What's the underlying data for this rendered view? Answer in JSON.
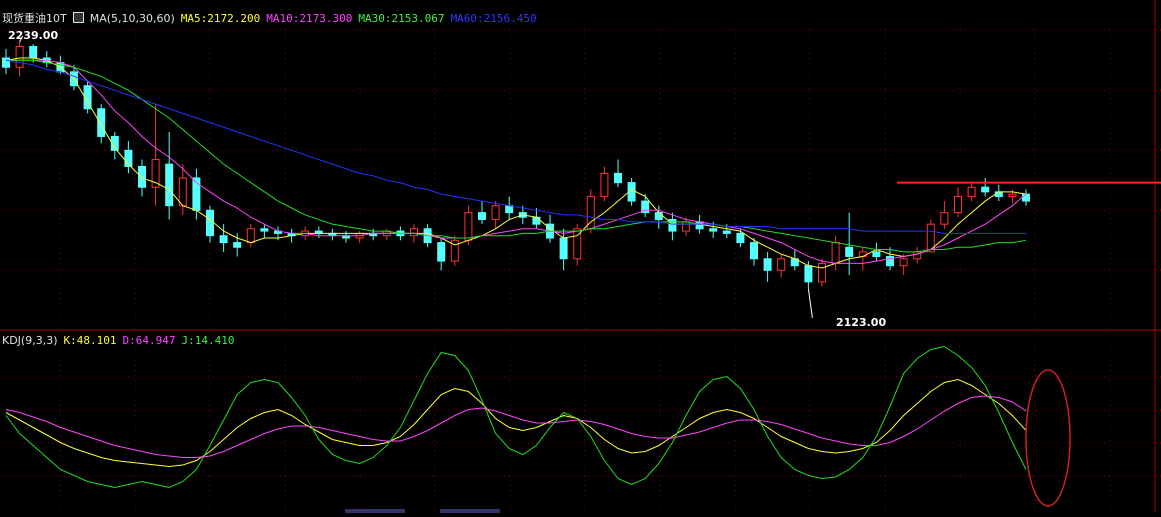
{
  "price_panel": {
    "symbol": "现货重油10T",
    "ma_params": "MA(5,10,30,60)",
    "ma5": "MA5:2172.200",
    "ma10": "MA10:2173.300",
    "ma30": "MA30:2153.067",
    "ma60": "MA60:2156.450",
    "high_label": "2239.00",
    "low_label": "2123.00"
  },
  "kdj_panel": {
    "params": "KDJ(9,3,3)",
    "k": "K:48.101",
    "d": "D:64.947",
    "j": "J:14.410"
  },
  "colors": {
    "up": "#ff3333",
    "down": "#54ffff",
    "ma5": "#ffff33",
    "ma10": "#ff44ff",
    "ma30": "#22dd22",
    "ma60": "#2233ff",
    "grid": "#7a0000",
    "resistance": "#ff2222",
    "annotation": "#cc2222"
  },
  "chart_data": [
    {
      "type": "candlestick",
      "ylim": [
        2115,
        2245
      ],
      "grid": true,
      "resistance_level": 2178,
      "candles": [
        [
          2232,
          2236,
          2225,
          2228
        ],
        [
          2228,
          2239,
          2224,
          2237
        ],
        [
          2237,
          2238,
          2230,
          2232
        ],
        [
          2232,
          2235,
          2228,
          2230
        ],
        [
          2230,
          2233,
          2225,
          2226
        ],
        [
          2226,
          2229,
          2218,
          2220
        ],
        [
          2220,
          2222,
          2208,
          2210
        ],
        [
          2210,
          2212,
          2195,
          2198
        ],
        [
          2198,
          2200,
          2188,
          2192
        ],
        [
          2192,
          2196,
          2182,
          2185
        ],
        [
          2185,
          2188,
          2172,
          2176
        ],
        [
          2176,
          2212,
          2168,
          2188
        ],
        [
          2186,
          2200,
          2162,
          2168
        ],
        [
          2168,
          2186,
          2164,
          2180
        ],
        [
          2180,
          2184,
          2162,
          2166
        ],
        [
          2166,
          2168,
          2152,
          2155
        ],
        [
          2155,
          2160,
          2148,
          2152
        ],
        [
          2152,
          2156,
          2146,
          2150
        ],
        [
          2152,
          2160,
          2150,
          2158
        ],
        [
          2158,
          2160,
          2154,
          2157
        ],
        [
          2157,
          2159,
          2153,
          2156
        ],
        [
          2156,
          2158,
          2152,
          2155
        ],
        [
          2155,
          2159,
          2153,
          2157
        ],
        [
          2157,
          2159,
          2154,
          2156
        ],
        [
          2156,
          2158,
          2153,
          2155
        ],
        [
          2155,
          2157,
          2152,
          2154
        ],
        [
          2154,
          2157,
          2152,
          2156
        ],
        [
          2156,
          2158,
          2153,
          2155
        ],
        [
          2155,
          2158,
          2153,
          2157
        ],
        [
          2157,
          2159,
          2153,
          2155
        ],
        [
          2155,
          2160,
          2152,
          2158
        ],
        [
          2158,
          2160,
          2150,
          2152
        ],
        [
          2152,
          2154,
          2140,
          2144
        ],
        [
          2144,
          2155,
          2142,
          2153
        ],
        [
          2153,
          2168,
          2151,
          2165
        ],
        [
          2165,
          2170,
          2160,
          2162
        ],
        [
          2162,
          2170,
          2158,
          2168
        ],
        [
          2168,
          2172,
          2162,
          2165
        ],
        [
          2165,
          2168,
          2160,
          2163
        ],
        [
          2163,
          2167,
          2158,
          2160
        ],
        [
          2160,
          2164,
          2152,
          2154
        ],
        [
          2154,
          2158,
          2140,
          2145
        ],
        [
          2145,
          2160,
          2142,
          2158
        ],
        [
          2158,
          2175,
          2156,
          2172
        ],
        [
          2172,
          2185,
          2170,
          2182
        ],
        [
          2182,
          2188,
          2176,
          2178
        ],
        [
          2178,
          2180,
          2168,
          2170
        ],
        [
          2170,
          2173,
          2163,
          2165
        ],
        [
          2165,
          2168,
          2158,
          2162
        ],
        [
          2162,
          2165,
          2153,
          2157
        ],
        [
          2157,
          2163,
          2155,
          2161
        ],
        [
          2161,
          2164,
          2156,
          2158
        ],
        [
          2158,
          2161,
          2154,
          2157
        ],
        [
          2157,
          2160,
          2154,
          2156
        ],
        [
          2156,
          2158,
          2150,
          2152
        ],
        [
          2152,
          2154,
          2142,
          2145
        ],
        [
          2145,
          2148,
          2135,
          2140
        ],
        [
          2140,
          2147,
          2137,
          2145
        ],
        [
          2145,
          2149,
          2140,
          2142
        ],
        [
          2142,
          2144,
          2132,
          2135
        ],
        [
          2135,
          2145,
          2133,
          2143
        ],
        [
          2143,
          2155,
          2140,
          2152
        ],
        [
          2150,
          2165,
          2138,
          2146
        ],
        [
          2146,
          2150,
          2140,
          2148
        ],
        [
          2148,
          2152,
          2144,
          2146
        ],
        [
          2146,
          2150,
          2140,
          2142
        ],
        [
          2142,
          2147,
          2138,
          2145
        ],
        [
          2145,
          2150,
          2143,
          2148
        ],
        [
          2148,
          2162,
          2150,
          2160
        ],
        [
          2160,
          2170,
          2158,
          2165
        ],
        [
          2165,
          2176,
          2163,
          2172
        ],
        [
          2172,
          2178,
          2170,
          2176
        ],
        [
          2176,
          2180,
          2172,
          2174
        ],
        [
          2174,
          2177,
          2170,
          2172
        ],
        [
          2172,
          2175,
          2169,
          2173
        ],
        [
          2173,
          2175,
          2168,
          2170
        ]
      ],
      "series": [
        {
          "values": [
            2231,
            2232,
            2232,
            2231,
            2228,
            2223,
            2213,
            2203,
            2193,
            2186,
            2180,
            2178,
            2175,
            2168,
            2166,
            2162,
            2157,
            2154,
            2152,
            2154,
            2154,
            2155,
            2156,
            2156,
            2156,
            2156,
            2156,
            2156,
            2156,
            2156,
            2156,
            2156,
            2154,
            2151,
            2153,
            2155,
            2158,
            2162,
            2164,
            2163,
            2158,
            2154,
            2155,
            2161,
            2165,
            2170,
            2175,
            2172,
            2165,
            2160,
            2160,
            2160,
            2159,
            2158,
            2157,
            2153,
            2150,
            2147,
            2145,
            2142,
            2141,
            2143,
            2145,
            2146,
            2149,
            2147,
            2146,
            2147,
            2149,
            2154,
            2160,
            2165,
            2170,
            2174,
            2174,
            2173
          ]
        },
        {
          "values": [
            2231,
            2231,
            2231,
            2231,
            2230,
            2228,
            2222,
            2216,
            2209,
            2204,
            2198,
            2193,
            2189,
            2184,
            2178,
            2174,
            2170,
            2167,
            2163,
            2160,
            2157,
            2156,
            2156,
            2155,
            2155,
            2155,
            2155,
            2156,
            2156,
            2156,
            2156,
            2155,
            2154,
            2154,
            2154,
            2155,
            2156,
            2157,
            2158,
            2158,
            2157,
            2156,
            2157,
            2158,
            2160,
            2162,
            2164,
            2166,
            2166,
            2164,
            2162,
            2161,
            2160,
            2159,
            2158,
            2156,
            2154,
            2152,
            2149,
            2146,
            2144,
            2143,
            2143,
            2143,
            2144,
            2145,
            2146,
            2147,
            2149,
            2151,
            2154,
            2157,
            2160,
            2164,
            2168,
            2173
          ]
        },
        {
          "values": [
            2231,
            2231,
            2231,
            2230,
            2229,
            2228,
            2226,
            2224,
            2221,
            2218,
            2214,
            2210,
            2206,
            2201,
            2196,
            2191,
            2186,
            2182,
            2178,
            2174,
            2170,
            2167,
            2164,
            2162,
            2160,
            2159,
            2158,
            2157,
            2157,
            2156,
            2156,
            2155,
            2155,
            2154,
            2154,
            2155,
            2155,
            2155,
            2156,
            2156,
            2157,
            2157,
            2157,
            2158,
            2158,
            2159,
            2160,
            2161,
            2161,
            2161,
            2161,
            2160,
            2160,
            2159,
            2159,
            2158,
            2157,
            2156,
            2155,
            2154,
            2153,
            2152,
            2151,
            2150,
            2149,
            2149,
            2148,
            2148,
            2149,
            2149,
            2150,
            2150,
            2151,
            2152,
            2152,
            2153
          ]
        },
        {
          "values": [
            2231,
            2230,
            2229,
            2227,
            2226,
            2224,
            2222,
            2220,
            2218,
            2216,
            2214,
            2212,
            2210,
            2208,
            2206,
            2204,
            2202,
            2200,
            2198,
            2196,
            2194,
            2192,
            2190,
            2188,
            2186,
            2184,
            2182,
            2181,
            2179,
            2178,
            2176,
            2175,
            2173,
            2172,
            2171,
            2170,
            2169,
            2168,
            2167,
            2166,
            2165,
            2164,
            2164,
            2163,
            2162,
            2162,
            2161,
            2161,
            2161,
            2160,
            2160,
            2160,
            2160,
            2159,
            2159,
            2159,
            2159,
            2158,
            2158,
            2158,
            2158,
            2158,
            2158,
            2157,
            2157,
            2157,
            2157,
            2157,
            2157,
            2156,
            2156,
            2156,
            2156,
            2156,
            2156,
            2156
          ]
        }
      ]
    },
    {
      "type": "line",
      "ylim": [
        -5,
        105
      ],
      "grid": true,
      "series": [
        {
          "values": [
            60,
            55,
            50,
            45,
            40,
            36,
            33,
            30,
            28,
            27,
            26,
            25,
            24,
            25,
            28,
            34,
            42,
            50,
            56,
            60,
            62,
            58,
            52,
            47,
            42,
            40,
            38,
            38,
            40,
            44,
            52,
            62,
            72,
            76,
            74,
            66,
            56,
            50,
            48,
            50,
            54,
            58,
            56,
            50,
            42,
            36,
            33,
            34,
            38,
            44,
            50,
            56,
            60,
            62,
            60,
            56,
            50,
            44,
            40,
            36,
            34,
            33,
            34,
            36,
            40,
            48,
            58,
            66,
            74,
            80,
            82,
            78,
            72,
            66,
            58,
            48
          ]
        },
        {
          "values": [
            62,
            60,
            57,
            54,
            50,
            47,
            44,
            41,
            38,
            36,
            34,
            32,
            31,
            30,
            30,
            31,
            34,
            38,
            42,
            46,
            49,
            51,
            51,
            50,
            48,
            46,
            44,
            42,
            41,
            41,
            44,
            48,
            53,
            58,
            62,
            63,
            61,
            58,
            55,
            53,
            53,
            54,
            55,
            54,
            52,
            49,
            46,
            44,
            43,
            43,
            45,
            47,
            50,
            53,
            55,
            55,
            54,
            52,
            49,
            46,
            43,
            41,
            39,
            38,
            38,
            40,
            44,
            49,
            55,
            61,
            66,
            70,
            71,
            70,
            67,
            61
          ]
        },
        {
          "values": [
            58,
            46,
            38,
            30,
            22,
            18,
            14,
            12,
            10,
            12,
            14,
            12,
            10,
            14,
            22,
            38,
            55,
            72,
            80,
            82,
            80,
            70,
            58,
            42,
            32,
            28,
            26,
            30,
            38,
            50,
            68,
            86,
            100,
            98,
            88,
            68,
            46,
            36,
            32,
            38,
            50,
            60,
            56,
            44,
            28,
            16,
            12,
            16,
            26,
            40,
            58,
            74,
            82,
            84,
            76,
            62,
            44,
            30,
            22,
            18,
            16,
            17,
            22,
            30,
            44,
            64,
            86,
            96,
            102,
            104,
            98,
            90,
            78,
            60,
            40,
            22
          ]
        }
      ]
    }
  ]
}
